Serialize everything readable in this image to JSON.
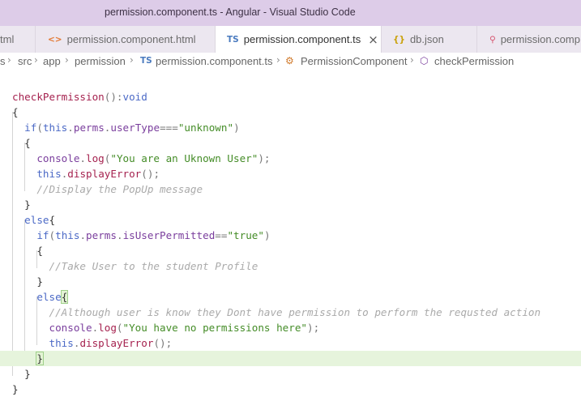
{
  "window": {
    "title": "permission.component.ts - Angular - Visual Studio Code"
  },
  "tabs": [
    {
      "label": "tml",
      "icon": "",
      "active": false
    },
    {
      "label": "permission.component.html",
      "icon": "<>",
      "active": false
    },
    {
      "label": "permission.component.ts",
      "icon": "TS",
      "active": true,
      "close": "×"
    },
    {
      "label": "db.json",
      "icon": "{}",
      "active": false
    },
    {
      "label": "permission.comp",
      "icon": "⚲",
      "active": false
    }
  ],
  "breadcrumb": {
    "items": [
      "s",
      "src",
      "app",
      "permission",
      "permission.component.ts",
      "PermissionComponent",
      "checkPermission"
    ],
    "ts_icon": "TS",
    "class_icon": "⚙",
    "method_icon": "⬡",
    "separator": "›"
  },
  "colors": {
    "titlebar": "#ddcce8",
    "tabbar": "#ece7f0",
    "keyword": "#4b69c6",
    "function": "#a5224f",
    "string": "#448c27",
    "comment": "#aaaaaa",
    "current_line": "#e6f4dc"
  },
  "code": {
    "lines": [
      {
        "tokens": [
          {
            "t": "checkPermission",
            "c": "fn"
          },
          {
            "t": "():",
            "c": "op"
          },
          {
            "t": "void",
            "c": "kw"
          }
        ]
      },
      {
        "tokens": [
          {
            "t": "{",
            "c": "plain"
          }
        ]
      },
      {
        "tokens": [
          {
            "t": "  ",
            "c": "plain"
          },
          {
            "t": "if",
            "c": "kw"
          },
          {
            "t": "(",
            "c": "op"
          },
          {
            "t": "this",
            "c": "kw"
          },
          {
            "t": ".",
            "c": "op"
          },
          {
            "t": "perms",
            "c": "prop"
          },
          {
            "t": ".",
            "c": "op"
          },
          {
            "t": "userType",
            "c": "prop"
          },
          {
            "t": "===",
            "c": "op"
          },
          {
            "t": "\"unknown\"",
            "c": "str"
          },
          {
            "t": ")",
            "c": "op"
          }
        ]
      },
      {
        "tokens": [
          {
            "t": "  {",
            "c": "plain"
          }
        ]
      },
      {
        "tokens": [
          {
            "t": "    ",
            "c": "plain"
          },
          {
            "t": "console",
            "c": "prop"
          },
          {
            "t": ".",
            "c": "op"
          },
          {
            "t": "log",
            "c": "fn"
          },
          {
            "t": "(",
            "c": "op"
          },
          {
            "t": "\"You are an Uknown User\"",
            "c": "str"
          },
          {
            "t": ");",
            "c": "op"
          }
        ]
      },
      {
        "tokens": [
          {
            "t": "    ",
            "c": "plain"
          },
          {
            "t": "this",
            "c": "kw"
          },
          {
            "t": ".",
            "c": "op"
          },
          {
            "t": "displayError",
            "c": "fn"
          },
          {
            "t": "();",
            "c": "op"
          }
        ]
      },
      {
        "tokens": [
          {
            "t": "    ",
            "c": "plain"
          },
          {
            "t": "//Display the PopUp message",
            "c": "cm"
          }
        ]
      },
      {
        "tokens": [
          {
            "t": "  }",
            "c": "plain"
          }
        ]
      },
      {
        "tokens": [
          {
            "t": "  ",
            "c": "plain"
          },
          {
            "t": "else",
            "c": "kw"
          },
          {
            "t": "{",
            "c": "plain"
          }
        ]
      },
      {
        "tokens": [
          {
            "t": "    ",
            "c": "plain"
          },
          {
            "t": "if",
            "c": "kw"
          },
          {
            "t": "(",
            "c": "op"
          },
          {
            "t": "this",
            "c": "kw"
          },
          {
            "t": ".",
            "c": "op"
          },
          {
            "t": "perms",
            "c": "prop"
          },
          {
            "t": ".",
            "c": "op"
          },
          {
            "t": "isUserPermitted",
            "c": "prop"
          },
          {
            "t": "==",
            "c": "op"
          },
          {
            "t": "\"true\"",
            "c": "str"
          },
          {
            "t": ")",
            "c": "op"
          }
        ]
      },
      {
        "tokens": [
          {
            "t": "    {",
            "c": "plain"
          }
        ]
      },
      {
        "tokens": [
          {
            "t": "      ",
            "c": "plain"
          },
          {
            "t": "//Take User to the student Profile",
            "c": "cm"
          }
        ]
      },
      {
        "tokens": [
          {
            "t": "    }",
            "c": "plain"
          }
        ]
      },
      {
        "tokens": [
          {
            "t": "    ",
            "c": "plain"
          },
          {
            "t": "else",
            "c": "kw"
          },
          {
            "t": "{",
            "c": "hl"
          }
        ]
      },
      {
        "tokens": [
          {
            "t": "      ",
            "c": "plain"
          },
          {
            "t": "//Although user is know they Dont have permission to perform the requsted action",
            "c": "cm"
          }
        ]
      },
      {
        "tokens": [
          {
            "t": "      ",
            "c": "plain"
          },
          {
            "t": "console",
            "c": "prop"
          },
          {
            "t": ".",
            "c": "op"
          },
          {
            "t": "log",
            "c": "fn"
          },
          {
            "t": "(",
            "c": "op"
          },
          {
            "t": "\"You have no permissions here\"",
            "c": "str"
          },
          {
            "t": ");",
            "c": "op"
          }
        ]
      },
      {
        "tokens": [
          {
            "t": "      ",
            "c": "plain"
          },
          {
            "t": "this",
            "c": "kw"
          },
          {
            "t": ".",
            "c": "op"
          },
          {
            "t": "displayError",
            "c": "fn"
          },
          {
            "t": "();",
            "c": "op"
          }
        ]
      },
      {
        "tokens": [
          {
            "t": "    ",
            "c": "plain"
          },
          {
            "t": "}",
            "c": "hl"
          }
        ],
        "current": true
      },
      {
        "tokens": [
          {
            "t": "  }",
            "c": "plain"
          }
        ]
      },
      {
        "tokens": [
          {
            "t": "}",
            "c": "plain"
          }
        ]
      }
    ]
  }
}
